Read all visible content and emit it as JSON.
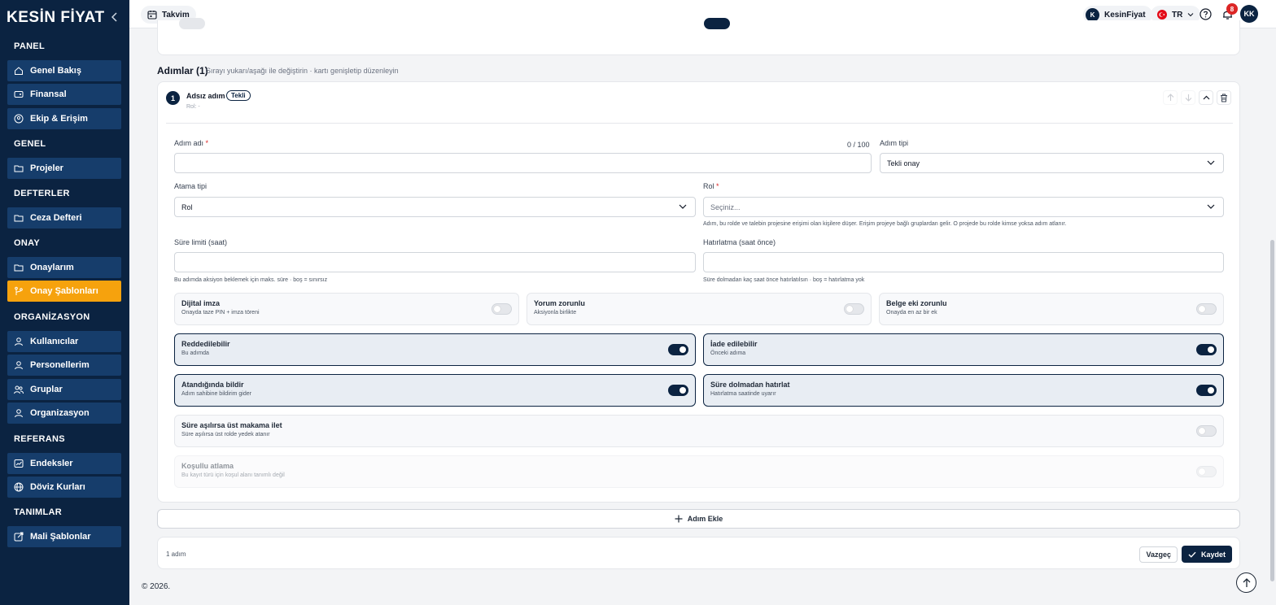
{
  "sidebar": {
    "logo": "KESİN FİYAT",
    "sections": {
      "panel": "PANEL",
      "genel": "GENEL",
      "defterler": "DEFTERLER",
      "onay": "ONAY",
      "organizasyon": "ORGANİZASYON",
      "referans": "REFERANS",
      "tanimlar": "TANIMLAR"
    },
    "items": [
      {
        "label": "Genel Bakış",
        "icon": "home-icon"
      },
      {
        "label": "Finansal",
        "icon": "wallet-icon"
      },
      {
        "label": "Ekip & Erişim",
        "icon": "team-icon"
      },
      {
        "label": "Projeler",
        "icon": "folder-icon"
      },
      {
        "label": "Ceza Defteri",
        "icon": "folder-icon"
      },
      {
        "label": "Onaylarım",
        "icon": "folder-icon"
      },
      {
        "label": "Onay Şablonları",
        "icon": "branch-icon",
        "active": true
      },
      {
        "label": "Kullanıcılar",
        "icon": "user-icon"
      },
      {
        "label": "Personellerim",
        "icon": "user-icon"
      },
      {
        "label": "Gruplar",
        "icon": "users-icon"
      },
      {
        "label": "Organizasyon",
        "icon": "user-icon"
      },
      {
        "label": "Endeksler",
        "icon": "chart-icon"
      },
      {
        "label": "Döviz Kurları",
        "icon": "globe-icon"
      },
      {
        "label": "Mali Şablonlar",
        "icon": "template-icon"
      }
    ]
  },
  "topbar": {
    "calendar_label": "Takvim",
    "account_initial": "K",
    "account_name": "KesinFiyat",
    "language": "TR",
    "notification_count": "8",
    "user_initials": "KK"
  },
  "steps": {
    "title": "Adımlar (1)",
    "subtitle": "Sırayı yukarı/aşağı ile değiştirin · kartı genişletip düzenleyin",
    "step": {
      "number": "1",
      "name": "Adsız adım",
      "tag": "Tekli",
      "role": "Rol: -"
    },
    "form": {
      "step_name_label": "Adım adı",
      "step_name_value": "",
      "step_name_counter": "0 / 100",
      "step_type_label": "Adım tipi",
      "step_type_value": "Tekli onay",
      "assign_type_label": "Atama tipi",
      "assign_type_value": "Rol",
      "role_label": "Rol",
      "role_placeholder": "Seçiniz...",
      "role_helper": "Adım, bu rolde ve talebin projesine erişimi olan kişilere düşer. Erişim projeye bağlı gruplardan gelir. O projede bu rolde kimse yoksa adım atlanır.",
      "time_limit_label": "Süre limiti (saat)",
      "time_limit_helper": "Bu adımda aksiyon beklemek için maks. süre · boş = sınırsız",
      "reminder_label": "Hatırlatma (saat önce)",
      "reminder_helper": "Süre dolmadan kaç saat önce hatırlatılsın · boş = hatırlatma yok"
    },
    "options": [
      {
        "title": "Dijital imza",
        "sub": "Onayda taze PIN + imza töreni",
        "on": false
      },
      {
        "title": "Yorum zorunlu",
        "sub": "Aksiyonla birlikte",
        "on": false
      },
      {
        "title": "Belge eki zorunlu",
        "sub": "Onayda en az bir ek",
        "on": false
      },
      {
        "title": "Reddedilebilir",
        "sub": "Bu adımda",
        "on": true
      },
      {
        "title": "İade edilebilir",
        "sub": "Önceki adıma",
        "on": true
      },
      {
        "title": "Atandığında bildir",
        "sub": "Adım sahibine bildirim gider",
        "on": true
      },
      {
        "title": "Süre dolmadan hatırlat",
        "sub": "Hatırlatma saatinde uyarır",
        "on": true
      },
      {
        "title": "Süre aşılırsa üst makama ilet",
        "sub": "Süre aşılırsa üst rolde yedek atanır",
        "on": false
      },
      {
        "title": "Koşullu atlama",
        "sub": "Bu kayıt türü için koşul alanı tanımlı değil",
        "on": false,
        "disabled": true
      }
    ],
    "add_step_label": "Adım Ekle"
  },
  "footer": {
    "count_text": "1 adım",
    "cancel_label": "Vazgeç",
    "save_label": "Kaydet",
    "copyright": "© 2026."
  },
  "colors": {
    "sidebar_bg": "#0b2341",
    "sidebar_item": "#163d6b",
    "active_item": "#f6a20d",
    "primary": "#0b2341",
    "danger": "#dc2626"
  }
}
